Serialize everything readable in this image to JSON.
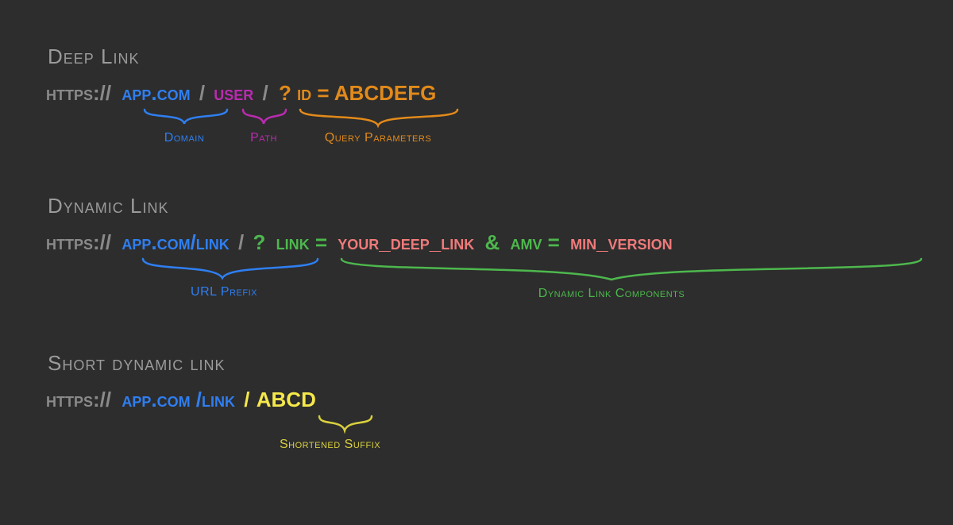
{
  "sections": {
    "deep": {
      "title": "Deep Link",
      "scheme": "https://",
      "domain": "app.com",
      "sep1": "/",
      "path": "user",
      "sep2": "/",
      "query": "? id = ABCDEFG",
      "labels": {
        "domain": "Domain",
        "path": "Path",
        "query": "Query Parameters"
      }
    },
    "dynamic": {
      "title": "Dynamic  Link",
      "scheme": "https://",
      "prefix": "app.com/link",
      "sep": "/",
      "q": "?",
      "p1k": "link =",
      "p1v": "your_deep_link",
      "amp": "&",
      "p2k": "amv =",
      "p2v": "min_version",
      "labels": {
        "prefix": "URL Prefix",
        "components": "Dynamic Link Components"
      }
    },
    "short": {
      "title": "Short dynamic link",
      "scheme": "https://",
      "prefix": "app.com /link",
      "sep": "/",
      "suffix": "ABCD",
      "labels": {
        "suffix": "Shortened Suffix"
      }
    }
  }
}
